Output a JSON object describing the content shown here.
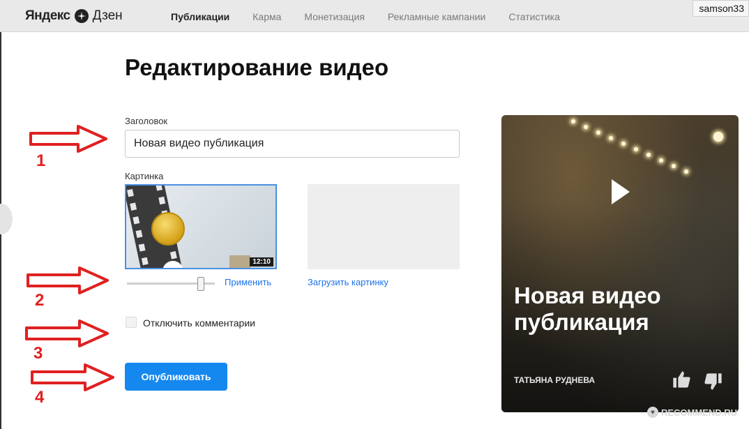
{
  "header": {
    "logo_brand": "Яндекс",
    "logo_product": "Дзен",
    "nav": [
      {
        "label": "Публикации",
        "active": true
      },
      {
        "label": "Карма",
        "active": false
      },
      {
        "label": "Монетизация",
        "active": false
      },
      {
        "label": "Рекламные кампании",
        "active": false
      },
      {
        "label": "Статистика",
        "active": false
      }
    ],
    "user": "samson33"
  },
  "main": {
    "page_title": "Редактирование видео",
    "title_field": {
      "label": "Заголовок",
      "value": "Новая видео публикация"
    },
    "image_field": {
      "label": "Картинка",
      "duration": "12:10",
      "apply_label": "Применить",
      "upload_label": "Загрузить картинку"
    },
    "comments_checkbox": {
      "label": "Отключить комментарии",
      "checked": false
    },
    "publish_button": "Опубликовать"
  },
  "annotations": {
    "steps": [
      "1",
      "2",
      "3",
      "4"
    ],
    "color": "#e02020"
  },
  "preview": {
    "title": "Новая видео публикация",
    "author": "ТАТЬЯНА РУДНЕВА"
  },
  "watermark": "RECOMMEND.RU",
  "colors": {
    "accent": "#1588ef",
    "link": "#1a73e8",
    "arrow": "#e02020"
  }
}
